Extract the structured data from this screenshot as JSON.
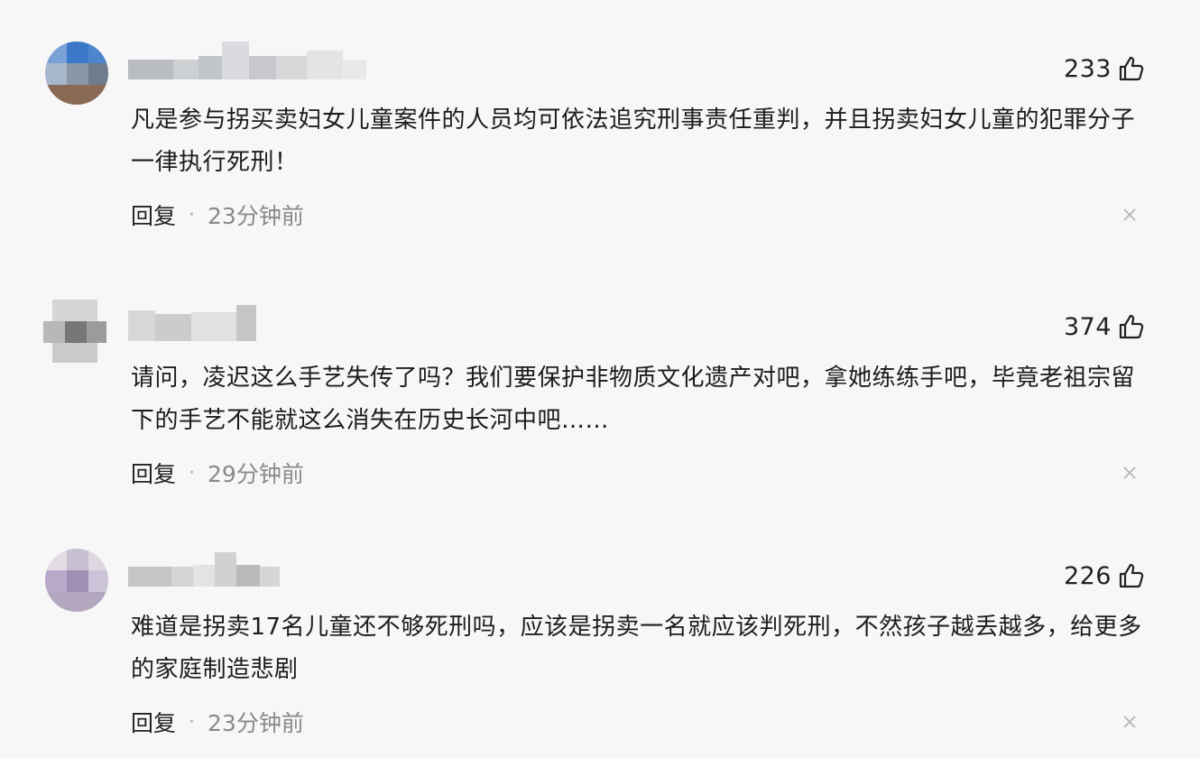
{
  "comments": [
    {
      "likes": "233",
      "text": "凡是参与拐买卖妇女儿童案件的人员均可依法追究刑事责任重判，并且拐卖妇女儿童的犯罪分子一律执行死刑！",
      "reply_label": "回复",
      "separator": "·",
      "timestamp": "23分钟前"
    },
    {
      "likes": "374",
      "text": "请问，凌迟这么手艺失传了吗？我们要保护非物质文化遗产对吧，拿她练练手吧，毕竟老祖宗留下的手艺不能就这么消失在历史长河中吧……",
      "reply_label": "回复",
      "separator": "·",
      "timestamp": "29分钟前"
    },
    {
      "likes": "226",
      "text": "难道是拐卖17名儿童还不够死刑吗，应该是拐卖一名就应该判死刑，不然孩子越丢越多，给更多的家庭制造悲剧",
      "reply_label": "回复",
      "separator": "·",
      "timestamp": "23分钟前"
    }
  ],
  "icons": {
    "like": "thumbs-up-icon",
    "close": "close-icon"
  },
  "colors": {
    "background": "#f7f7f8",
    "text": "#222222",
    "muted": "#8a8a8a"
  }
}
